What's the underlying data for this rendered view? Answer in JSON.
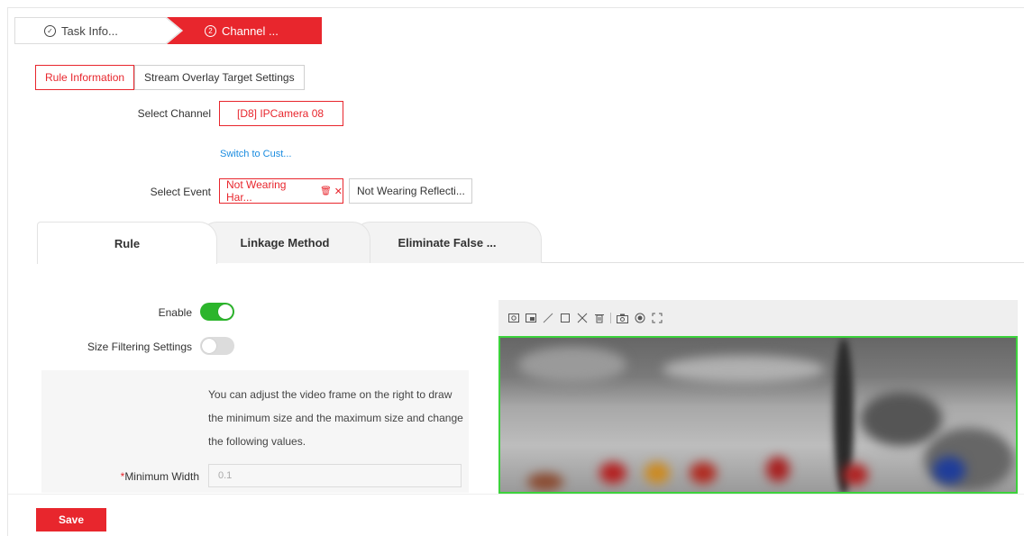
{
  "steps": [
    {
      "num": "✓",
      "label": "Task Info..."
    },
    {
      "num": "2",
      "label": "Channel ..."
    }
  ],
  "subtabs": [
    "Rule Information",
    "Stream Overlay Target Settings"
  ],
  "channel": {
    "label": "Select Channel",
    "value": "[D8] IPCamera 08",
    "switch_link": "Switch to Cust..."
  },
  "event": {
    "label": "Select Event",
    "selected": "Not Wearing Har...",
    "other": "Not Wearing Reflecti..."
  },
  "rule_tabs": [
    "Rule",
    "Linkage Method",
    "Eliminate False ..."
  ],
  "enable": {
    "label": "Enable",
    "on": true
  },
  "size_filter": {
    "label": "Size Filtering Settings",
    "on": false
  },
  "note": "You can adjust the video frame on the right to draw the minimum size and the maximum size and change the following values.",
  "min_width": {
    "required": "*",
    "label": "Minimum Width",
    "placeholder": "0.1"
  },
  "save_label": "Save",
  "colors": {
    "accent": "#e8262d",
    "toggle_on": "#2cb52c",
    "link": "#1a8ce0",
    "video_border": "#3cd23c"
  }
}
